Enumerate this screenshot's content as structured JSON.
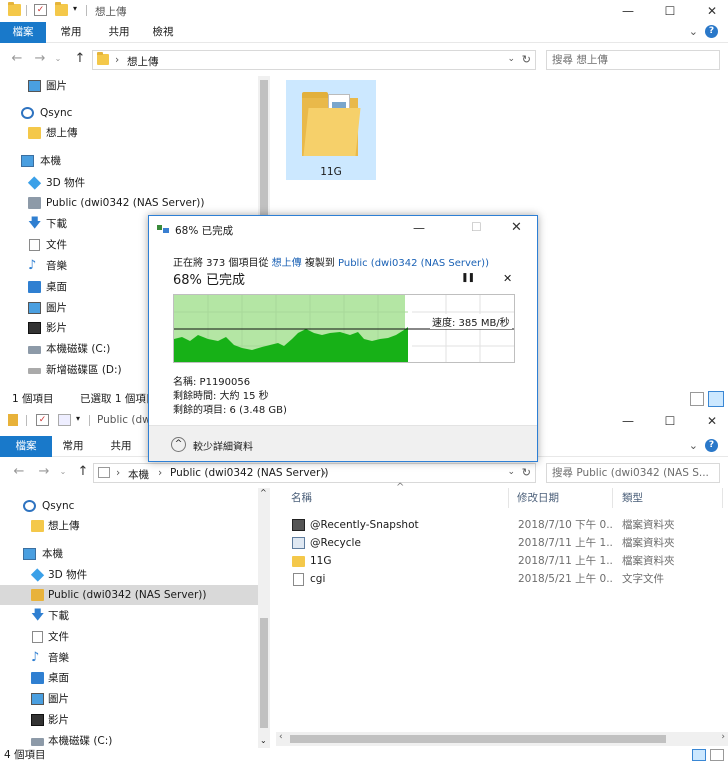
{
  "top_window": {
    "title": "想上傳",
    "ribbon_tabs": [
      "檔案",
      "常用",
      "共用",
      "檢視"
    ],
    "breadcrumb": [
      "想上傳"
    ],
    "search_placeholder": "搜尋 想上傳",
    "nav_items": [
      {
        "label": "圖片",
        "icon": "pictures-icon"
      },
      {
        "label": "Qsync",
        "icon": "qsync-icon"
      },
      {
        "label": "想上傳",
        "icon": "folder-icon"
      },
      {
        "label": "本機",
        "icon": "this-pc-icon"
      },
      {
        "label": "3D 物件",
        "icon": "3d-objects-icon"
      },
      {
        "label": "Public (dwi0342 (NAS Server))",
        "icon": "network-drive-icon"
      },
      {
        "label": "下載",
        "icon": "downloads-icon"
      },
      {
        "label": "文件",
        "icon": "documents-icon"
      },
      {
        "label": "音樂",
        "icon": "music-icon"
      },
      {
        "label": "桌面",
        "icon": "desktop-icon"
      },
      {
        "label": "圖片",
        "icon": "pictures-icon"
      },
      {
        "label": "影片",
        "icon": "videos-icon"
      },
      {
        "label": "本機磁碟 (C:)",
        "icon": "local-disk-icon"
      },
      {
        "label": "新增磁碟區 (D:)",
        "icon": "drive-icon"
      }
    ],
    "folder_tile": {
      "label": "11G"
    },
    "status": {
      "items": "1 個項目",
      "selected": "已選取 1 個項目"
    }
  },
  "copy_dialog": {
    "title": "68% 已完成",
    "line_prefix": "正在將 373 個項目從",
    "source": "想上傳",
    "copy_to": "複製到",
    "destination": "Public (dwi0342 (NAS Server))",
    "progress_label": "68% 已完成",
    "progress": 0.68,
    "speed": "速度: 385 MB/秒",
    "name": "名稱: P1190056",
    "time_left": "剩餘時間: 大約 15 秒",
    "items_left": "剩餘的項目: 6 (3.48 GB)",
    "details_toggle": "較少詳細資料",
    "pause_glyph": "❚❚",
    "close_glyph": "✕"
  },
  "bottom_window": {
    "title": "Public (dwi0342 (NAS Server))",
    "ribbon_tabs": [
      "檔案",
      "常用",
      "共用"
    ],
    "breadcrumb": [
      "本機",
      "Public (dwi0342 (NAS Server))"
    ],
    "search_placeholder": "搜尋 Public (dwi0342 (NAS S...",
    "nav_items": [
      {
        "label": "Qsync",
        "icon": "qsync-icon"
      },
      {
        "label": "想上傳",
        "icon": "folder-icon"
      },
      {
        "label": "本機",
        "icon": "this-pc-icon"
      },
      {
        "label": "3D 物件",
        "icon": "3d-objects-icon"
      },
      {
        "label": "Public (dwi0342 (NAS Server))",
        "icon": "network-drive-icon"
      },
      {
        "label": "下載",
        "icon": "downloads-icon"
      },
      {
        "label": "文件",
        "icon": "documents-icon"
      },
      {
        "label": "音樂",
        "icon": "music-icon"
      },
      {
        "label": "桌面",
        "icon": "desktop-icon"
      },
      {
        "label": "圖片",
        "icon": "pictures-icon"
      },
      {
        "label": "影片",
        "icon": "videos-icon"
      },
      {
        "label": "本機磁碟 (C:)",
        "icon": "local-disk-icon"
      }
    ],
    "columns": [
      "名稱",
      "修改日期",
      "類型"
    ],
    "files": [
      {
        "name": "@Recently-Snapshot",
        "date": "2018/7/10 下午 0...",
        "type": "檔案資料夾",
        "icon": "snapshot-folder-icon"
      },
      {
        "name": "@Recycle",
        "date": "2018/7/11 上午 1...",
        "type": "檔案資料夾",
        "icon": "recycle-folder-icon"
      },
      {
        "name": "11G",
        "date": "2018/7/11 上午 1...",
        "type": "檔案資料夾",
        "icon": "folder-icon"
      },
      {
        "name": "cgi",
        "date": "2018/5/21 上午 0...",
        "type": "文字文件",
        "icon": "text-file-icon"
      }
    ],
    "status": {
      "items": "4 個項目"
    }
  }
}
